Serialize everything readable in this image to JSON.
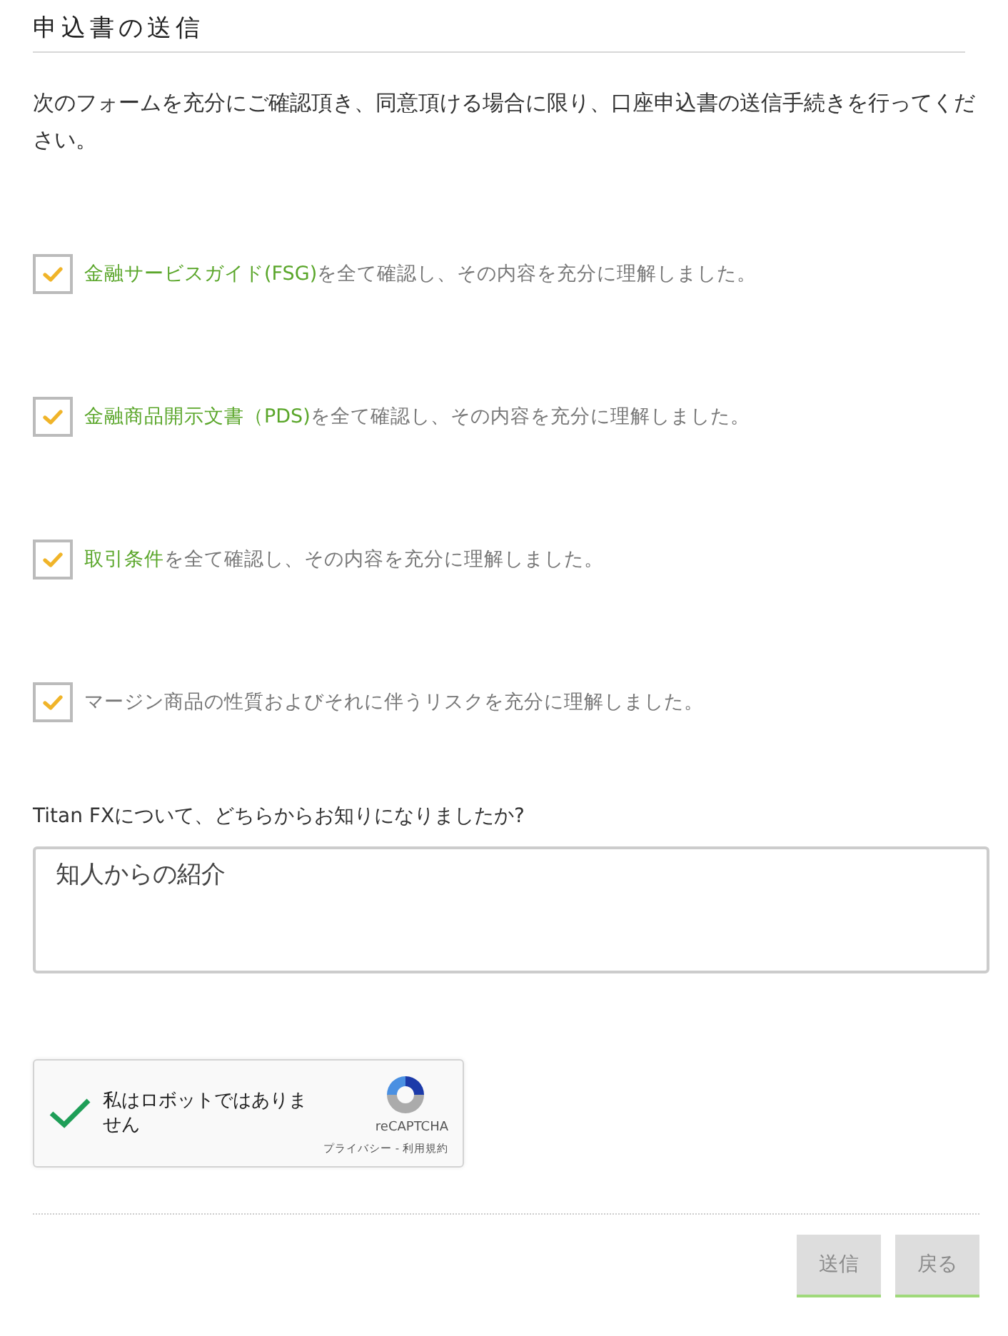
{
  "title": "申込書の送信",
  "intro": "次のフォームを充分にご確認頂き、同意頂ける場合に限り、口座申込書の送信手続きを行ってください。",
  "agreements": [
    {
      "checked": true,
      "link": "金融サービスガイド(FSG)",
      "text": "を全て確認し、その内容を充分に理解しました。"
    },
    {
      "checked": true,
      "link": "金融商品開示文書（PDS)",
      "text": "を全て確認し、その内容を充分に理解しました。"
    },
    {
      "checked": true,
      "link": "取引条件",
      "text": "を全て確認し、その内容を充分に理解しました。"
    },
    {
      "checked": true,
      "text": "マージン商品の性質およびそれに伴うリスクを充分に理解しました。"
    }
  ],
  "question": {
    "label": "Titan FXについて、どちらからお知りになりましたか?",
    "value": "知人からの紹介"
  },
  "captcha": {
    "checked": true,
    "label": "私はロボットではありません",
    "brand": "reCAPTCHA",
    "links": "プライバシー - 利用規約"
  },
  "buttons": [
    {
      "label": "送信",
      "disabled": true
    },
    {
      "label": "戻る",
      "disabled": true
    }
  ]
}
